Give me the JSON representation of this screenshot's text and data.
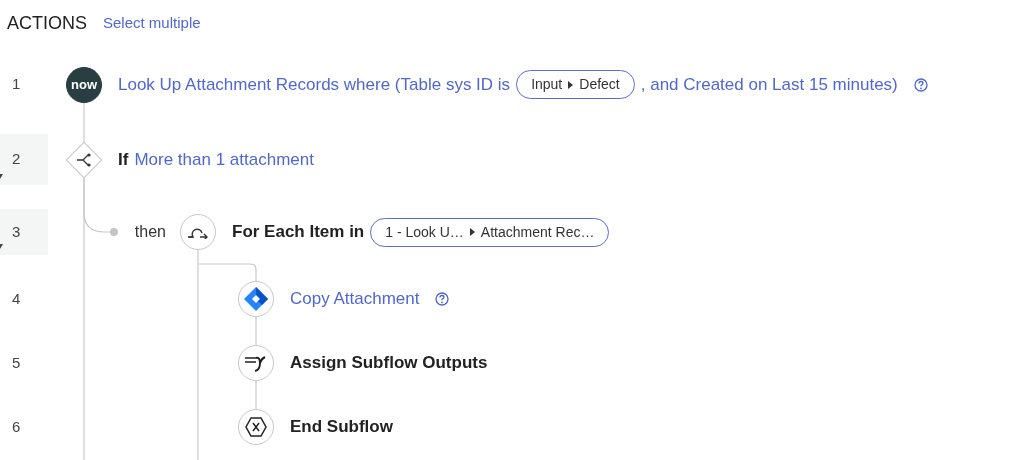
{
  "header": {
    "title": "ACTIONS",
    "link": "Select multiple"
  },
  "steps": [
    {
      "number": "1",
      "kind": "now",
      "badge_text": "now",
      "collapsible": false,
      "help": true,
      "parts": [
        {
          "kind": "link",
          "text": "Look Up Attachment Records where (Table sys ID is"
        },
        {
          "kind": "pill",
          "segments": [
            "Input",
            "Defect"
          ]
        },
        {
          "kind": "link",
          "text": ", and Created on Last 15 minutes)"
        }
      ]
    },
    {
      "number": "2",
      "kind": "branch",
      "collapsible": true,
      "help": false,
      "parts": [
        {
          "kind": "keyword",
          "text": "If"
        },
        {
          "kind": "link",
          "text": "More than 1 attachment"
        }
      ],
      "children": [
        {
          "number": "3",
          "kind": "loop",
          "branch_label": "then",
          "collapsible": true,
          "help": false,
          "parts": [
            {
              "kind": "keyword",
              "text": "For Each Item in"
            },
            {
              "kind": "pill",
              "segments": [
                "1 - Look U…",
                "Attachment Rec…"
              ]
            }
          ],
          "children": [
            {
              "number": "4",
              "kind": "jira",
              "collapsible": false,
              "help": true,
              "parts": [
                {
                  "kind": "link",
                  "text": "Copy Attachment"
                }
              ]
            },
            {
              "number": "5",
              "kind": "assign",
              "collapsible": false,
              "help": false,
              "parts": [
                {
                  "kind": "keyword",
                  "text": "Assign Subflow Outputs"
                }
              ]
            },
            {
              "number": "6",
              "kind": "end",
              "collapsible": false,
              "help": false,
              "parts": [
                {
                  "kind": "keyword",
                  "text": "End Subflow"
                }
              ]
            }
          ]
        }
      ]
    }
  ]
}
